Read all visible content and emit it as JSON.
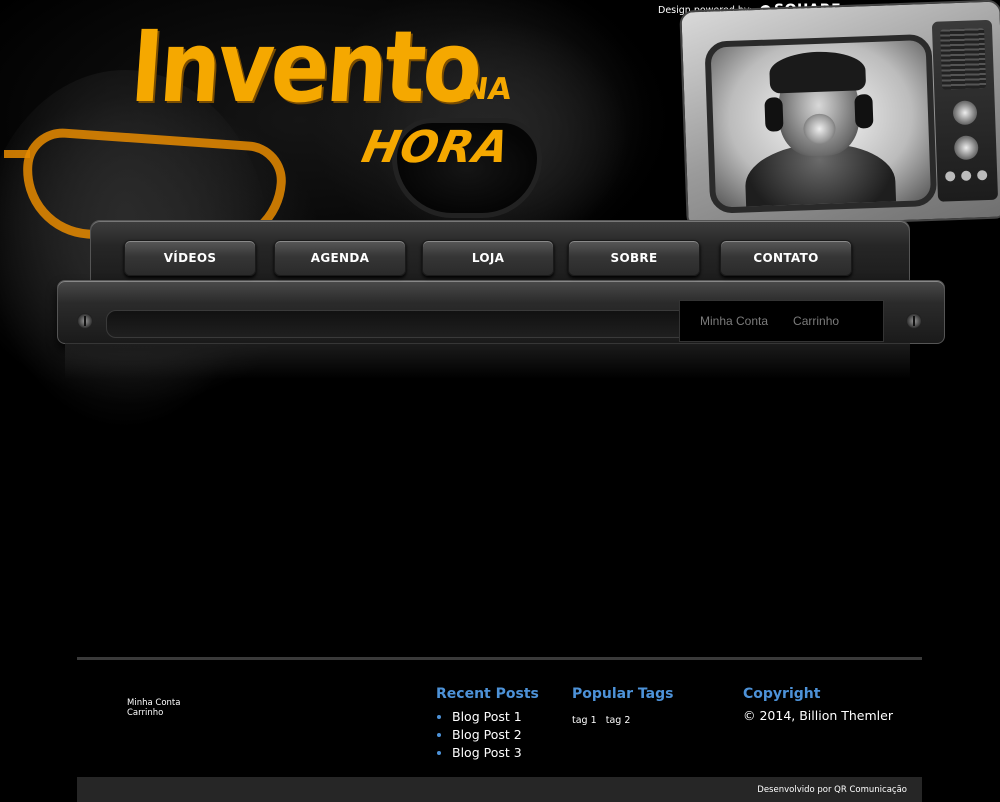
{
  "header": {
    "logo": {
      "main": "Invento",
      "small": "NA",
      "sub": "HORA"
    },
    "powered_by": {
      "label": "Design powered by:",
      "brand": "SQUARE"
    }
  },
  "nav": {
    "items": [
      {
        "label": "VÍDEOS"
      },
      {
        "label": "AGENDA"
      },
      {
        "label": "LOJA"
      },
      {
        "label": "SOBRE"
      },
      {
        "label": "CONTATO"
      }
    ]
  },
  "account": {
    "my_account": "Minha Conta",
    "cart": "Carrinho"
  },
  "footer": {
    "links": [
      "Minha Conta",
      "Carrinho"
    ],
    "recent_posts": {
      "title": "Recent Posts",
      "items": [
        "Blog Post 1",
        "Blog Post 2",
        "Blog Post 3"
      ]
    },
    "popular_tags": {
      "title": "Popular Tags",
      "items": [
        "tag 1",
        "tag 2"
      ]
    },
    "copyright": {
      "title": "Copyright",
      "text": "© 2014, Billion Themler"
    },
    "developer": "Desenvolvido por QR Comunicação"
  },
  "colors": {
    "logo": "#f5a800",
    "footer_heading": "#4d92d8",
    "background": "#000000"
  }
}
